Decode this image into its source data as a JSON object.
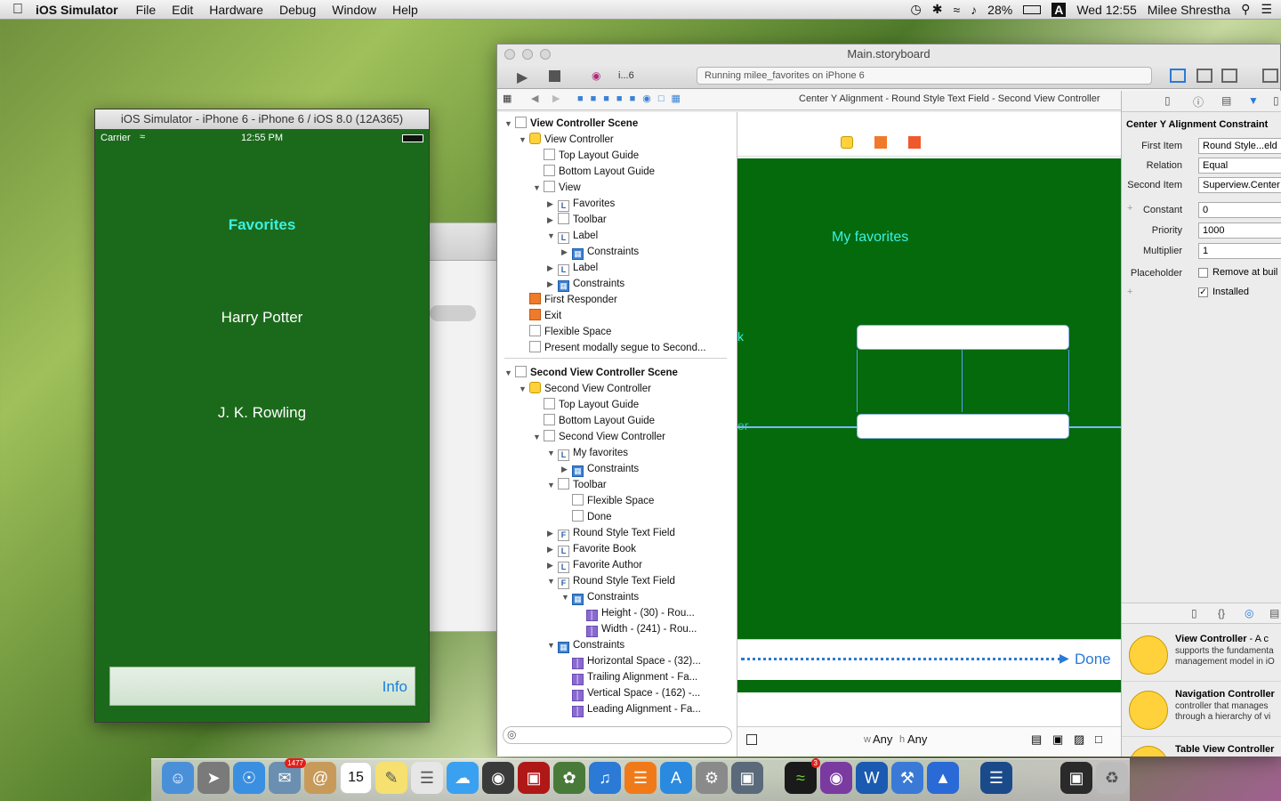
{
  "menubar": {
    "apple": "",
    "app_name": "iOS Simulator",
    "menus": [
      "File",
      "Edit",
      "Hardware",
      "Debug",
      "Window",
      "Help"
    ],
    "battery": "28%",
    "clock": "Wed 12:55",
    "user": "Milee Shrestha"
  },
  "simulator": {
    "window_title": "iOS Simulator - iPhone 6 - iPhone 6 / iOS 8.0 (12A365)",
    "carrier": "Carrier",
    "time": "12:55 PM",
    "heading": "Favorites",
    "book": "Harry Potter",
    "author": "J. K. Rowling",
    "info_button": "Info"
  },
  "xcode": {
    "window_title": "Main.storyboard",
    "scheme": "i...6",
    "activity": "Running milee_favorites on iPhone 6",
    "breadcrumb": "Center Y Alignment - Round Style Text Field - Second View Controller",
    "outline": [
      {
        "label": "View Controller Scene",
        "indent": 0,
        "icon": "scene",
        "tri": "▼",
        "bold": true
      },
      {
        "label": "View Controller",
        "indent": 1,
        "icon": "yellow",
        "tri": "▼"
      },
      {
        "label": "Top Layout Guide",
        "indent": 2,
        "icon": "plain",
        "tri": ""
      },
      {
        "label": "Bottom Layout Guide",
        "indent": 2,
        "icon": "plain",
        "tri": ""
      },
      {
        "label": "View",
        "indent": 2,
        "icon": "plain",
        "tri": "▼"
      },
      {
        "label": "Favorites",
        "indent": 3,
        "icon": "L",
        "tri": "▶"
      },
      {
        "label": "Toolbar",
        "indent": 3,
        "icon": "plain",
        "tri": "▶"
      },
      {
        "label": "Label",
        "indent": 3,
        "icon": "L",
        "tri": "▼"
      },
      {
        "label": "Constraints",
        "indent": 4,
        "icon": "blue",
        "tri": "▶"
      },
      {
        "label": "Label",
        "indent": 3,
        "icon": "L",
        "tri": "▶"
      },
      {
        "label": "Constraints",
        "indent": 3,
        "icon": "blue",
        "tri": "▶"
      },
      {
        "label": "First Responder",
        "indent": 1,
        "icon": "orange",
        "tri": ""
      },
      {
        "label": "Exit",
        "indent": 1,
        "icon": "orange",
        "tri": ""
      },
      {
        "label": "Flexible Space",
        "indent": 1,
        "icon": "plain",
        "tri": ""
      },
      {
        "label": "Present modally segue to Second...",
        "indent": 1,
        "icon": "plain",
        "tri": ""
      },
      {
        "label": "Second View Controller Scene",
        "indent": 0,
        "icon": "scene",
        "tri": "▼",
        "bold": true
      },
      {
        "label": "Second View Controller",
        "indent": 1,
        "icon": "yellow",
        "tri": "▼"
      },
      {
        "label": "Top Layout Guide",
        "indent": 2,
        "icon": "plain",
        "tri": ""
      },
      {
        "label": "Bottom Layout Guide",
        "indent": 2,
        "icon": "plain",
        "tri": ""
      },
      {
        "label": "Second View Controller",
        "indent": 2,
        "icon": "plain",
        "tri": "▼"
      },
      {
        "label": "My favorites",
        "indent": 3,
        "icon": "L",
        "tri": "▼"
      },
      {
        "label": "Constraints",
        "indent": 4,
        "icon": "blue",
        "tri": "▶"
      },
      {
        "label": "Toolbar",
        "indent": 3,
        "icon": "plain",
        "tri": "▼"
      },
      {
        "label": "Flexible Space",
        "indent": 4,
        "icon": "plain",
        "tri": ""
      },
      {
        "label": "Done",
        "indent": 4,
        "icon": "plain",
        "tri": ""
      },
      {
        "label": "Round Style Text Field",
        "indent": 3,
        "icon": "F",
        "tri": "▶"
      },
      {
        "label": "Favorite Book",
        "indent": 3,
        "icon": "L",
        "tri": "▶"
      },
      {
        "label": "Favorite Author",
        "indent": 3,
        "icon": "L",
        "tri": "▶"
      },
      {
        "label": "Round Style Text Field",
        "indent": 3,
        "icon": "F",
        "tri": "▼"
      },
      {
        "label": "Constraints",
        "indent": 4,
        "icon": "blue",
        "tri": "▼"
      },
      {
        "label": "Height - (30) - Rou...",
        "indent": 5,
        "icon": "purple",
        "tri": ""
      },
      {
        "label": "Width - (241) - Rou...",
        "indent": 5,
        "icon": "purple",
        "tri": ""
      },
      {
        "label": "Constraints",
        "indent": 3,
        "icon": "blue",
        "tri": "▼"
      },
      {
        "label": "Horizontal Space - (32)...",
        "indent": 4,
        "icon": "purple",
        "tri": ""
      },
      {
        "label": "Trailing Alignment - Fa...",
        "indent": 4,
        "icon": "purple",
        "tri": ""
      },
      {
        "label": "Vertical Space - (162) -...",
        "indent": 4,
        "icon": "purple",
        "tri": ""
      },
      {
        "label": "Leading Alignment - Fa...",
        "indent": 4,
        "icon": "purple",
        "tri": ""
      }
    ],
    "canvas": {
      "title": "My favorites",
      "done": "Done",
      "size_w": "Any",
      "size_h": "Any",
      "w_prefix": "w",
      "h_prefix": "h",
      "partial_k": "k",
      "partial_er": "er"
    },
    "inspector": {
      "section": "Center Y Alignment Constraint",
      "first_item_label": "First Item",
      "first_item": "Round Style...eld",
      "relation_label": "Relation",
      "relation": "Equal",
      "second_item_label": "Second Item",
      "second_item": "Superview.Center",
      "constant_label": "Constant",
      "constant": "0",
      "priority_label": "Priority",
      "priority": "1000",
      "multiplier_label": "Multiplier",
      "multiplier": "1",
      "placeholder_label": "Placeholder",
      "placeholder_option": "Remove at buil",
      "installed_label": "Installed",
      "library": [
        {
          "title": "View Controller",
          "desc": " - A c",
          "line2": "supports the fundamenta",
          "line3": "management model in iO"
        },
        {
          "title": "Navigation Controller",
          "desc": "",
          "line2": "controller that manages",
          "line3": "through a hierarchy of vi"
        },
        {
          "title": "Table View Controller",
          "desc": "",
          "line2": "controller that manages",
          "line3": ""
        }
      ]
    }
  },
  "dock": {
    "badge_mail": "1477",
    "calendar_day": "15",
    "badge_other": "3"
  }
}
